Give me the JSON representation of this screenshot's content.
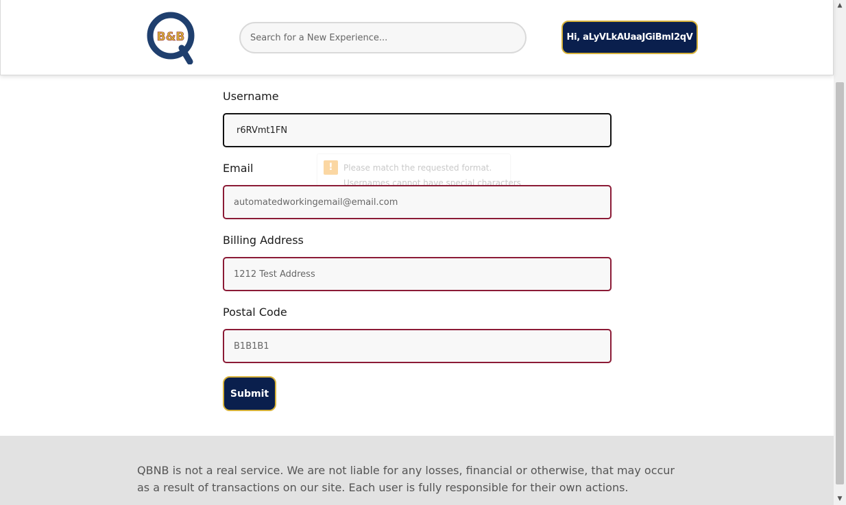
{
  "header": {
    "logo_text": "B&B",
    "search_placeholder": "Search for a New Experience...",
    "user_button_label": "Hi, aLyVLkAUaaJGiBmI2qV"
  },
  "form": {
    "username": {
      "label": "Username",
      "value": "r6RVmt1FN"
    },
    "tooltip": {
      "line1": "Please match the requested format.",
      "line2": "Usernames cannot have special characters"
    },
    "email": {
      "label": "Email",
      "placeholder": "automatedworkingemail@email.com"
    },
    "billing": {
      "label": "Billing Address",
      "placeholder": "1212 Test Address"
    },
    "postal": {
      "label": "Postal Code",
      "placeholder": "B1B1B1"
    },
    "submit_label": "Submit"
  },
  "footer": {
    "text": "QBNB is not a real service. We are not liable for any losses, financial or otherwise, that may occur as a result of transactions on our site. Each user is fully responsible for their own actions."
  },
  "colors": {
    "navy": "#0a1f4d",
    "gold": "#d7b23a",
    "maroon": "#8b1a35"
  }
}
